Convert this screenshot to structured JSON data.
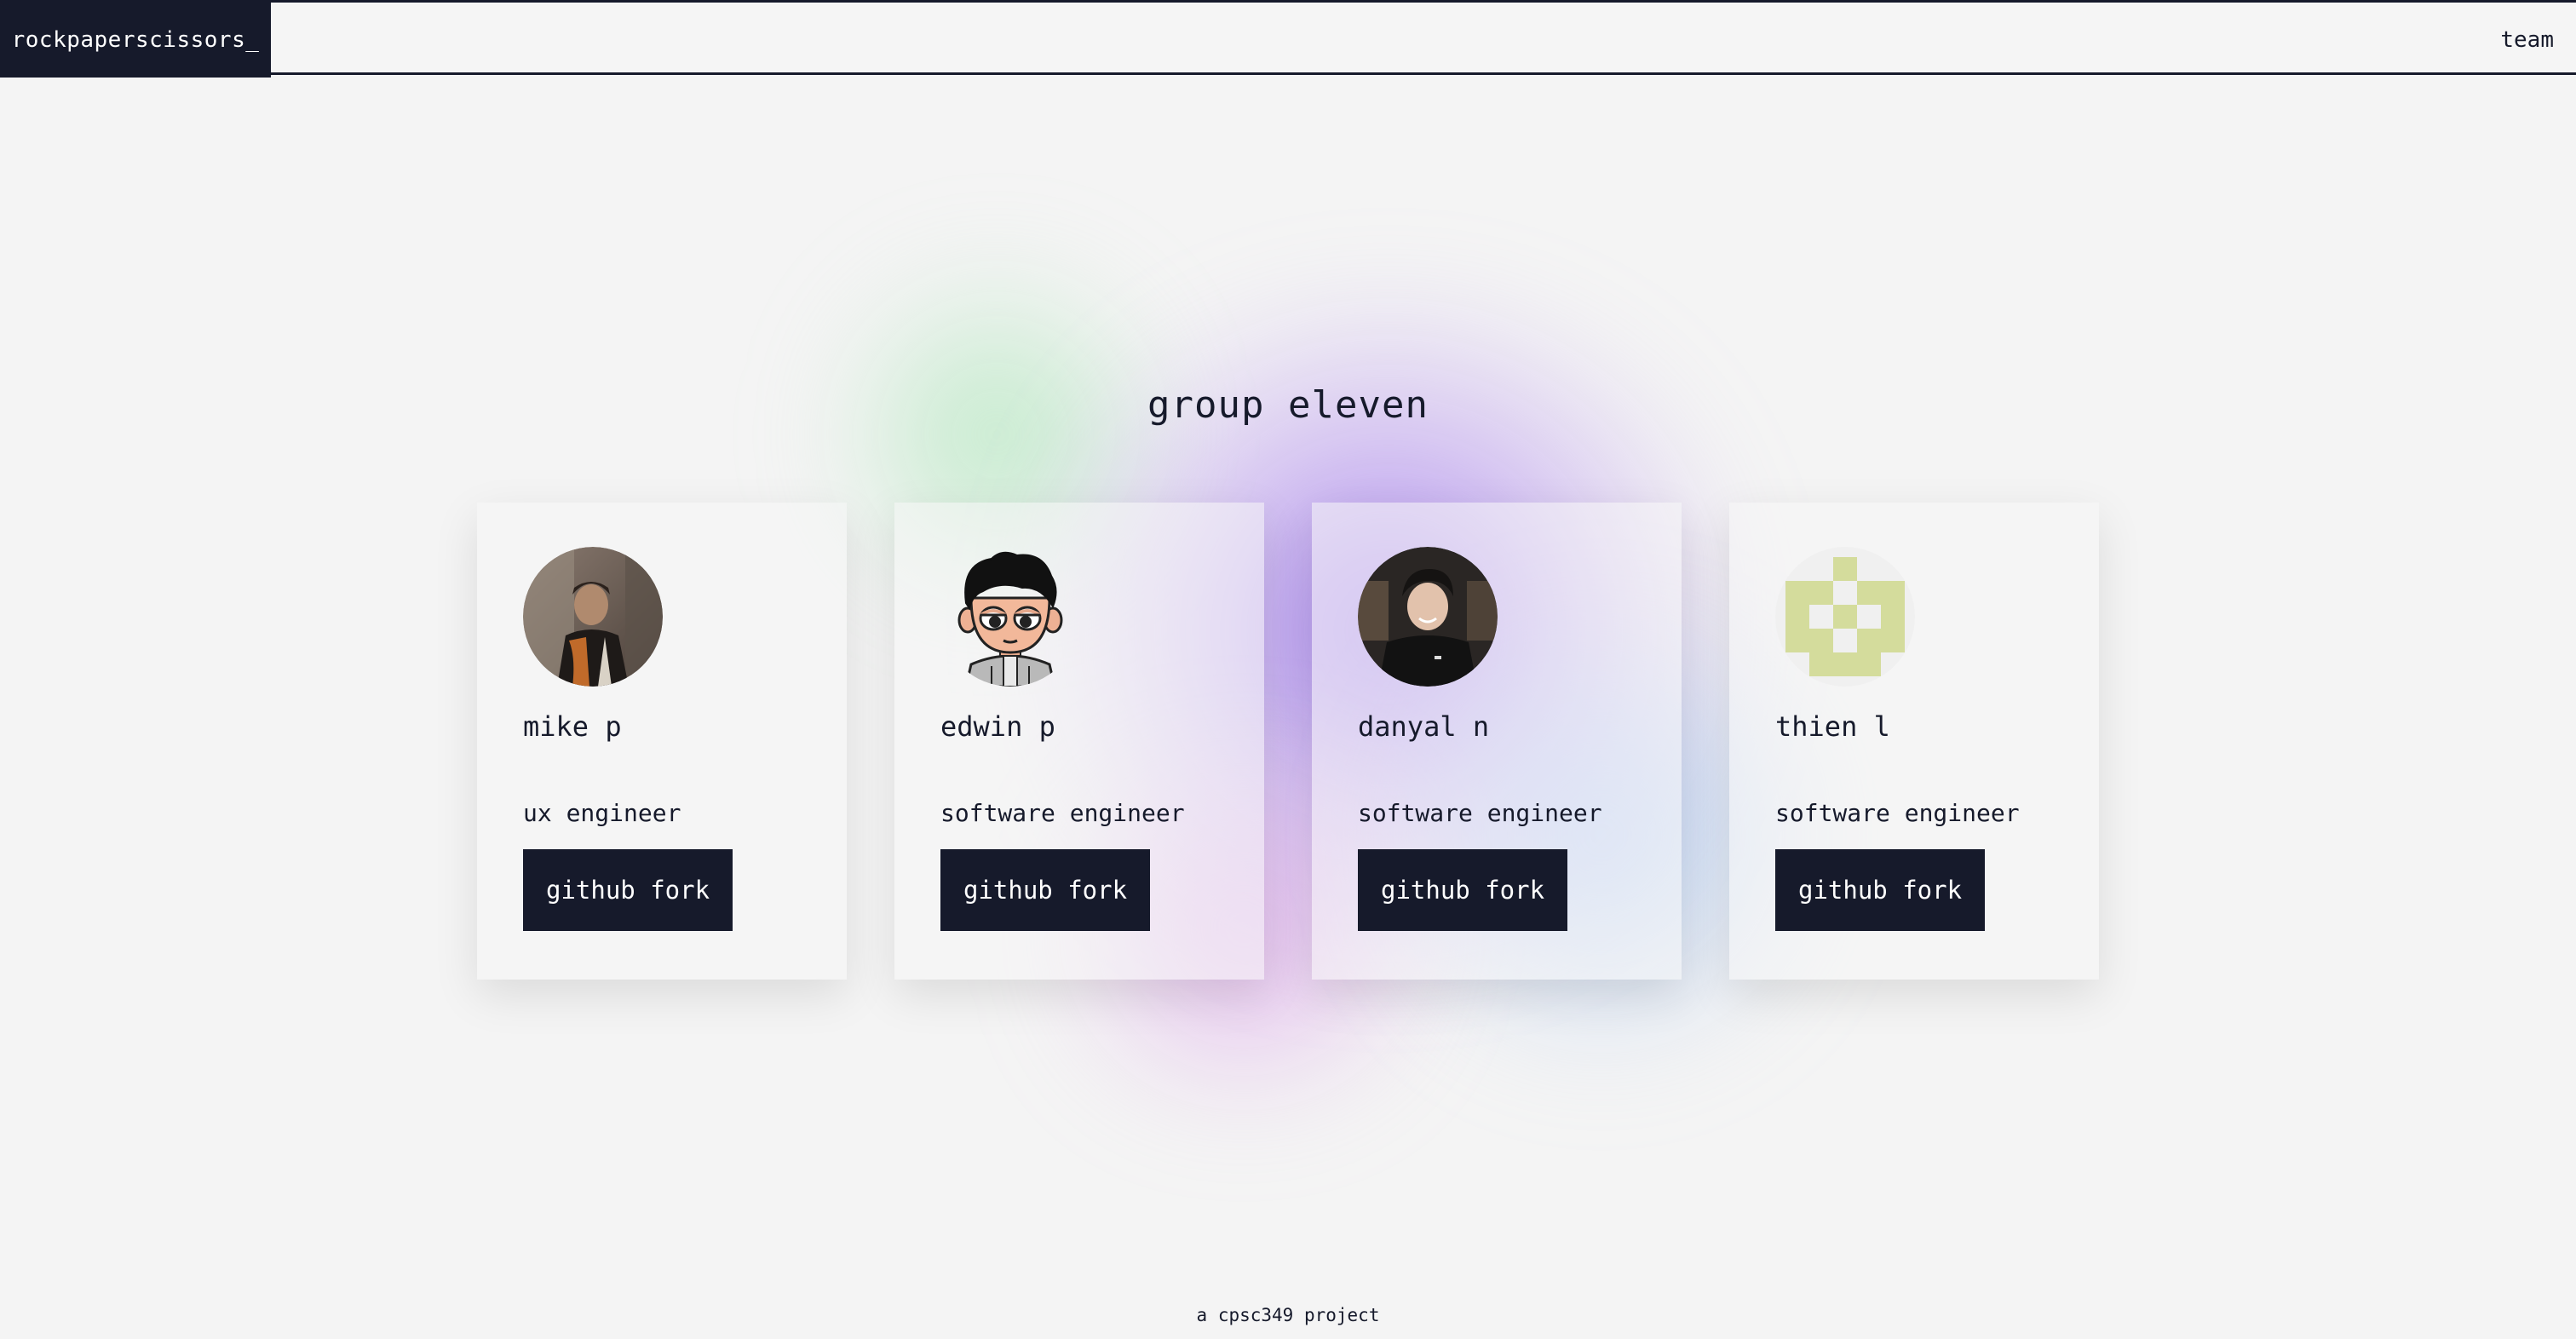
{
  "nav": {
    "brand": "rockpaperscissors_",
    "team_link": "team"
  },
  "heading": "group eleven",
  "members": [
    {
      "name": "mike p",
      "role": "ux engineer",
      "button_label": "github fork",
      "avatar_icon": "photo-avatar"
    },
    {
      "name": "edwin p",
      "role": "software engineer",
      "button_label": "github fork",
      "avatar_icon": "cartoon-avatar"
    },
    {
      "name": "danyal n",
      "role": "software engineer",
      "button_label": "github fork",
      "avatar_icon": "photo-avatar"
    },
    {
      "name": "thien l",
      "role": "software engineer",
      "button_label": "github fork",
      "avatar_icon": "identicon-avatar"
    }
  ],
  "footer": "a cpsc349 project",
  "colors": {
    "navy": "#161a2b",
    "background": "#f4f4f4",
    "identicon": "#d4dc9c"
  }
}
